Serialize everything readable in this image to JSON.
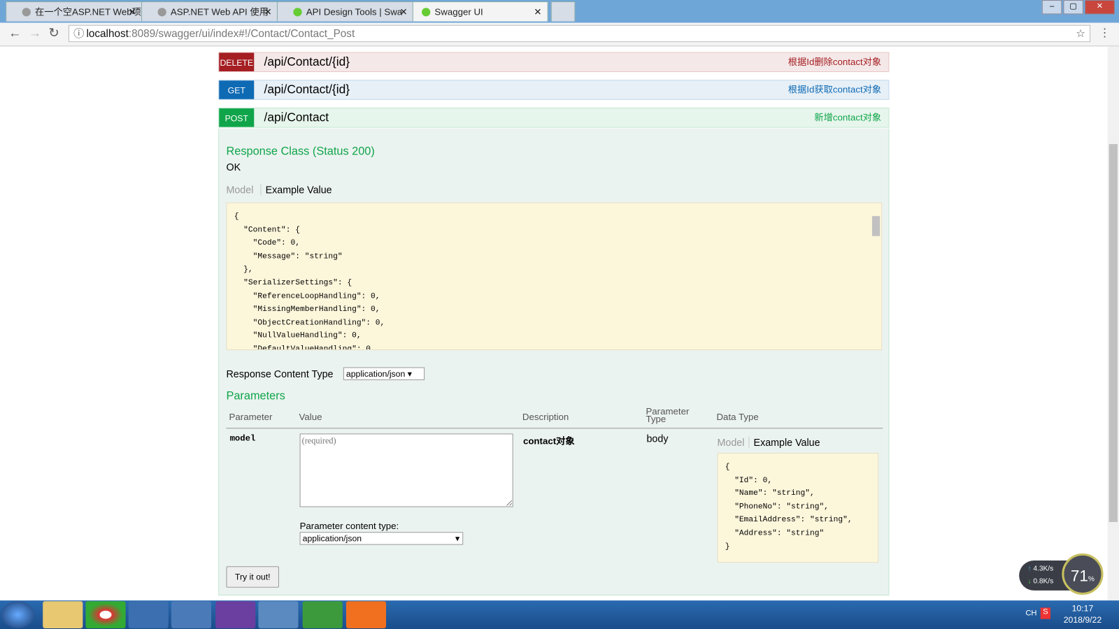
{
  "browser": {
    "tabs": [
      {
        "title": "在一个空ASP.NET Web项",
        "active": false
      },
      {
        "title": "ASP.NET Web API 使用",
        "active": false
      },
      {
        "title": "API Design Tools | Swa",
        "active": false
      },
      {
        "title": "Swagger UI",
        "active": true
      }
    ],
    "url_host": "localhost",
    "url_rest": ":8089/swagger/ui/index#!/Contact/Contact_Post"
  },
  "operations": [
    {
      "method": "DELETE",
      "path": "/api/Contact/{id}",
      "summary": "根据Id删除contact对象",
      "color": "#a41e22"
    },
    {
      "method": "GET",
      "path": "/api/Contact/{id}",
      "summary": "根据Id获取contact对象",
      "color": "#0f6ab4"
    },
    {
      "method": "POST",
      "path": "/api/Contact",
      "summary": "新增contact对象",
      "color": "#10a54a"
    }
  ],
  "post": {
    "response_class_title": "Response Class (Status 200)",
    "response_class_value": "OK",
    "model_tab": "Model",
    "example_tab": "Example Value",
    "response_example": "{\n  \"Content\": {\n    \"Code\": 0,\n    \"Message\": \"string\"\n  },\n  \"SerializerSettings\": {\n    \"ReferenceLoopHandling\": 0,\n    \"MissingMemberHandling\": 0,\n    \"ObjectCreationHandling\": 0,\n    \"NullValueHandling\": 0,\n    \"DefaultValueHandling\": 0",
    "response_content_type_label": "Response Content Type",
    "response_content_type": "application/json",
    "parameters_title": "Parameters",
    "columns": [
      "Parameter",
      "Value",
      "Description",
      "Parameter Type",
      "Data Type"
    ],
    "param": {
      "name": "model",
      "placeholder": "(required)",
      "description": "contact对象",
      "type": "body",
      "content_type_label": "Parameter content type:",
      "content_type": "application/json",
      "example": "{\n  \"Id\": 0,\n  \"Name\": \"string\",\n  \"PhoneNo\": \"string\",\n  \"EmailAddress\": \"string\",\n  \"Address\": \"string\"\n}"
    },
    "try_button": "Try it out!"
  },
  "widget": {
    "up": "4.3K/s",
    "down": "0.8K/s",
    "percent": "71",
    "unit": "%"
  },
  "taskbar": {
    "lang": "CH",
    "time": "10:17",
    "date": "2018/9/22"
  }
}
